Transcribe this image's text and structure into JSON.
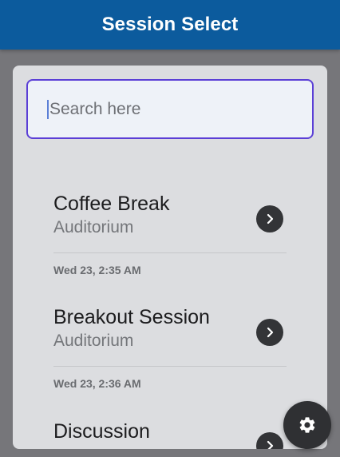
{
  "header": {
    "title": "Session Select"
  },
  "search": {
    "placeholder": "Search here",
    "value": ""
  },
  "sessions": [
    {
      "title": "Coffee Break",
      "location": "Auditorium",
      "time": "Wed 23, 2:35 AM"
    },
    {
      "title": "Breakout Session",
      "location": "Auditorium",
      "time": "Wed 23, 2:36 AM"
    },
    {
      "title": "Discussion"
    }
  ],
  "icons": {
    "row_action": "chevron-right-icon",
    "fab": "gear-icon"
  },
  "colors": {
    "header": "#0c5b9d",
    "search_border": "#5b3fd6",
    "button": "#333437"
  }
}
